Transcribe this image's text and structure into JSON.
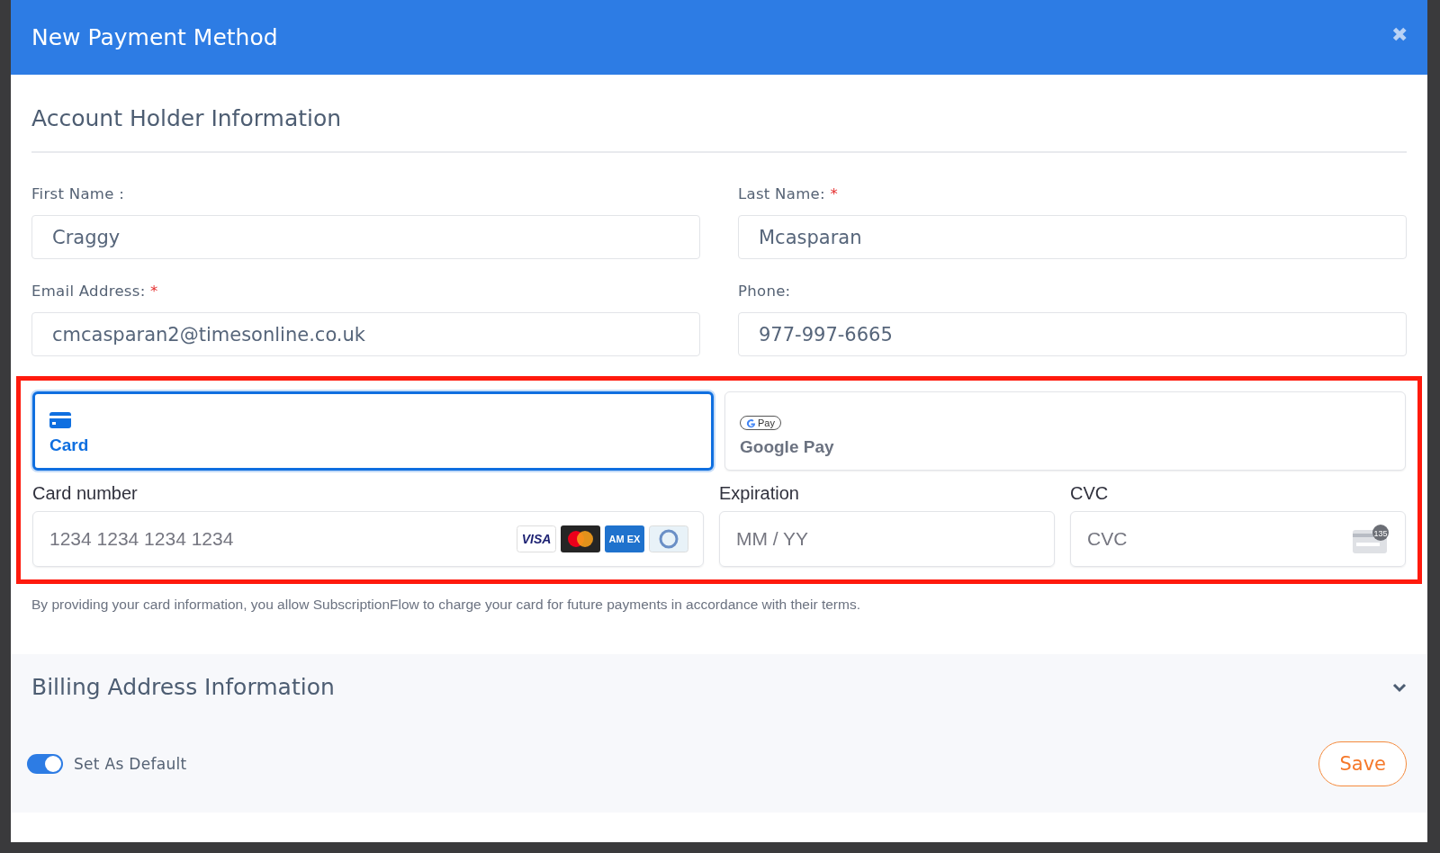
{
  "modal": {
    "title": "New Payment Method",
    "close": "✖"
  },
  "account_section": {
    "title": "Account Holder Information",
    "fields": [
      {
        "label": "First Name :",
        "value": "Craggy"
      },
      {
        "label": "Last Name:",
        "required_mark": "*",
        "value": "Mcasparan"
      },
      {
        "label": "Email Address:",
        "required_mark": "*",
        "value": "cmcasparan2@timesonline.co.uk"
      },
      {
        "label": "Phone:",
        "value": "977-997-6665"
      }
    ]
  },
  "payment": {
    "highlighted": true,
    "methods": [
      {
        "kind": "card",
        "label": "Card",
        "selected": true
      },
      {
        "kind": "gpay",
        "label": "Google Pay",
        "badge": "Pay",
        "selected": false
      }
    ],
    "fields": [
      {
        "kind": "number",
        "label": "Card number",
        "placeholder": "1234 1234 1234 1234",
        "brands": [
          {
            "kind": "visa",
            "label": "VISA"
          },
          {
            "kind": "mastercard"
          },
          {
            "kind": "amex",
            "label": "AM EX"
          },
          {
            "kind": "diners"
          }
        ]
      },
      {
        "kind": "expiry",
        "label": "Expiration",
        "placeholder": "MM / YY"
      },
      {
        "kind": "cvc",
        "label": "CVC",
        "placeholder": "CVC",
        "badge": "135"
      }
    ],
    "notice": "By providing your card information, you allow SubscriptionFlow to charge your card for future payments in accordance with their terms."
  },
  "billing_section": {
    "title": "Billing Address Information",
    "expanded": false
  },
  "default_toggle": {
    "label": "Set As Default",
    "on": true
  },
  "save_button": "Save"
}
